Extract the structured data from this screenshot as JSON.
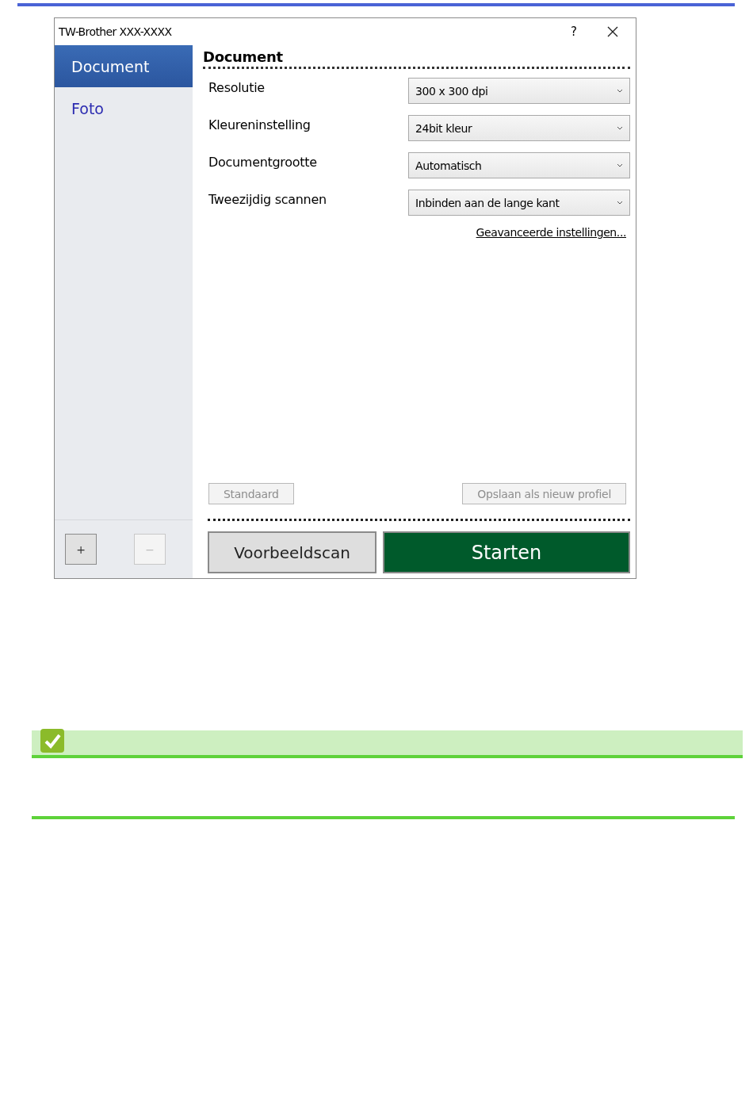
{
  "window": {
    "title": "TW-Brother XXX-XXXX",
    "help": "?"
  },
  "sidebar": {
    "items": [
      {
        "label": "Document",
        "selected": true
      },
      {
        "label": "Foto",
        "selected": false
      }
    ],
    "buttons": [
      {
        "label": "+",
        "disabled": false
      },
      {
        "label": "−",
        "disabled": true
      }
    ]
  },
  "panel": {
    "heading": "Document",
    "settings": [
      {
        "label": "Resolutie",
        "value": "300 x 300 dpi"
      },
      {
        "label": "Kleureninstelling",
        "value": "24bit kleur"
      },
      {
        "label": "Documentgrootte",
        "value": "Automatisch"
      },
      {
        "label": "Tweezijdig scannen",
        "value": "Inbinden aan de lange kant"
      }
    ],
    "advanced_link": "Geavanceerde instellingen...",
    "profile_buttons": [
      {
        "label": "Standaard",
        "disabled": true
      },
      {
        "label": "Opslaan als nieuw profiel",
        "disabled": true
      }
    ],
    "preview_button": "Voorbeeldscan",
    "start_button": "Starten"
  },
  "note": {
    "kind": "check"
  }
}
